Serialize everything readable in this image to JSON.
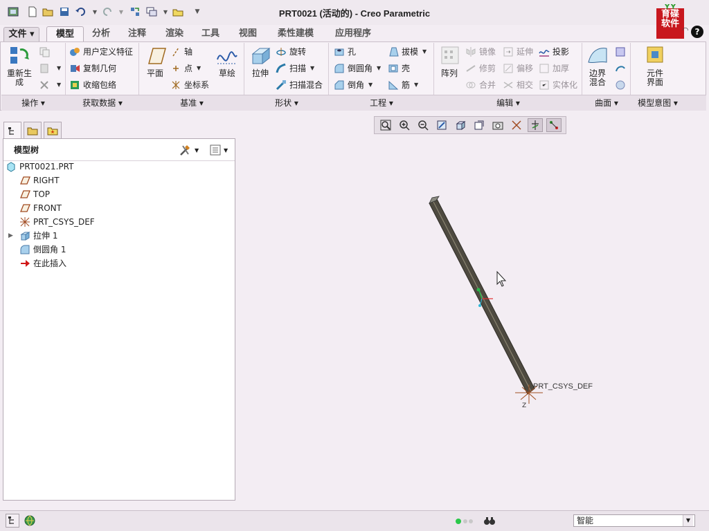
{
  "window": {
    "title": "PRT0021 (活动的) - Creo Parametric"
  },
  "logo": {
    "line1": "育碟",
    "line2": "软件"
  },
  "tabs": [
    {
      "label": "文件 ▾"
    },
    {
      "label": "模型"
    },
    {
      "label": "分析"
    },
    {
      "label": "注释"
    },
    {
      "label": "渲染"
    },
    {
      "label": "工具"
    },
    {
      "label": "视图"
    },
    {
      "label": "柔性建模"
    },
    {
      "label": "应用程序"
    }
  ],
  "ribbon": {
    "regenerate": "重新生成",
    "user_defined_feature": "用户定义特征",
    "copy_geometry": "复制几何",
    "shrinkwrap": "收缩包络",
    "plane": "平面",
    "axis": "轴",
    "point": "点",
    "csys": "坐标系",
    "sketch": "草绘",
    "extrude": "拉伸",
    "revolve": "旋转",
    "sweep": "扫描",
    "swept_blend": "扫描混合",
    "hole": "孔",
    "round": "倒圆角",
    "chamfer": "倒角",
    "draft": "拔模",
    "shell": "壳",
    "rib": "筋",
    "pattern": "阵列",
    "mirror": "镜像",
    "trim": "修剪",
    "merge": "合并",
    "extend": "延伸",
    "offset": "偏移",
    "intersect": "相交",
    "project": "投影",
    "thicken": "加厚",
    "solidify": "实体化",
    "boundary_blend": "边界混合",
    "component_interface": "元件界面"
  },
  "groups": [
    {
      "label": "操作 ▾"
    },
    {
      "label": "获取数据 ▾"
    },
    {
      "label": "基准 ▾"
    },
    {
      "label": "形状 ▾"
    },
    {
      "label": "工程 ▾"
    },
    {
      "label": "编辑 ▾"
    },
    {
      "label": "曲面 ▾"
    },
    {
      "label": "模型意图 ▾"
    }
  ],
  "panel": {
    "title": "模型树",
    "items": [
      {
        "label": "PRT0021.PRT"
      },
      {
        "label": "RIGHT"
      },
      {
        "label": "TOP"
      },
      {
        "label": "FRONT"
      },
      {
        "label": "PRT_CSYS_DEF"
      },
      {
        "label": "拉伸 1"
      },
      {
        "label": "倒圆角 1"
      },
      {
        "label": "在此插入"
      }
    ]
  },
  "canvas": {
    "csys_label": "PRT_CSYS_DEF",
    "z_label": "Z"
  },
  "status": {
    "filter_value": "智能"
  },
  "colors": {
    "logo_red": "#c8171e",
    "background": "#f3edf3",
    "insert_arrow": "#d01818"
  }
}
